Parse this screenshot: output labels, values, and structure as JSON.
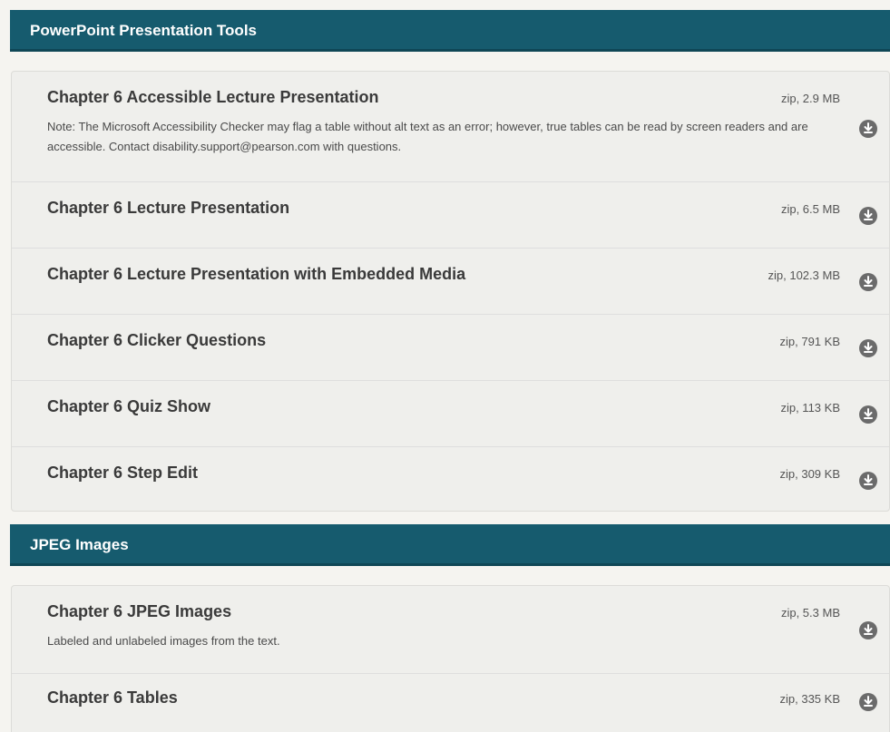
{
  "sections": [
    {
      "title": "PowerPoint Presentation Tools",
      "items": [
        {
          "title": "Chapter 6 Accessible Lecture Presentation",
          "size": "zip, 2.9 MB",
          "note": "Note: The Microsoft Accessibility Checker may flag a table without alt text as an error; however, true tables can be read by screen readers and are accessible. Contact disability.support@pearson.com with questions."
        },
        {
          "title": "Chapter 6 Lecture Presentation",
          "size": "zip, 6.5 MB"
        },
        {
          "title": "Chapter 6 Lecture Presentation with Embedded Media",
          "size": "zip, 102.3 MB"
        },
        {
          "title": "Chapter 6 Clicker Questions",
          "size": "zip, 791 KB"
        },
        {
          "title": "Chapter 6 Quiz Show",
          "size": "zip, 113 KB"
        },
        {
          "title": "Chapter 6 Step Edit",
          "size": "zip, 309 KB"
        }
      ]
    },
    {
      "title": "JPEG Images",
      "items": [
        {
          "title": "Chapter 6 JPEG Images",
          "size": "zip, 5.3 MB",
          "note": "Labeled and unlabeled images from the text."
        },
        {
          "title": "Chapter 6 Tables",
          "size": "zip, 335 KB"
        }
      ]
    }
  ],
  "icons": {
    "download": "download-icon"
  },
  "colors": {
    "header_bg": "#165b6e",
    "header_text": "#ffffff",
    "page_bg": "#f5f4f0",
    "row_bg": "#efefec",
    "icon": "#6b6b6b"
  }
}
